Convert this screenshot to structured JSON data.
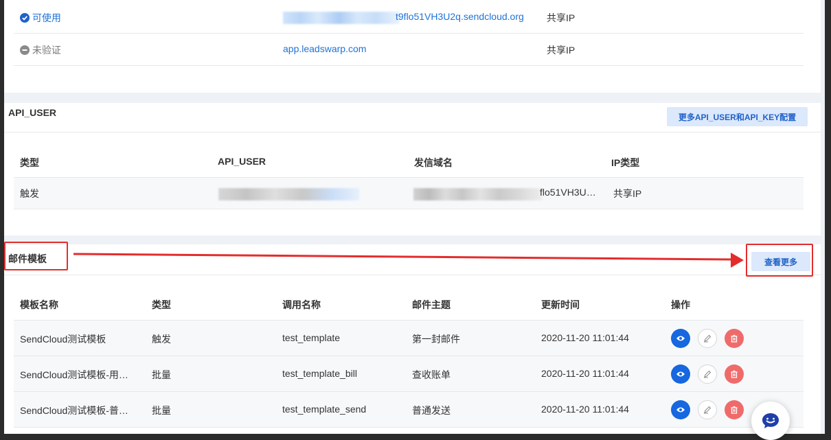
{
  "domains": {
    "rows": [
      {
        "status": "可使用",
        "domain": "t9flo51VH3U2q.sendcloud.org",
        "ip": "共享IP"
      },
      {
        "status": "未验证",
        "domain": "app.leadswarp.com",
        "ip": "共享IP"
      }
    ]
  },
  "api_user": {
    "title": "API_USER",
    "more_button": "更多API_USER和API_KEY配置",
    "headers": [
      "类型",
      "API_USER",
      "发信域名",
      "IP类型"
    ],
    "row": {
      "type": "触发",
      "domain_suffix": "flo51VH3U…",
      "ip": "共享IP"
    }
  },
  "templates": {
    "title": "邮件模板",
    "more_button": "查看更多",
    "headers": [
      "模板名称",
      "类型",
      "调用名称",
      "邮件主题",
      "更新时间",
      "操作"
    ],
    "rows": [
      {
        "name": "SendCloud测试模板",
        "type": "触发",
        "call": "test_template",
        "subject": "第一封邮件",
        "time": "2020-11-20 11:01:44"
      },
      {
        "name": "SendCloud测试模板-用…",
        "type": "批量",
        "call": "test_template_bill",
        "subject": "查收账单",
        "time": "2020-11-20 11:01:44"
      },
      {
        "name": "SendCloud测试模板-普…",
        "type": "批量",
        "call": "test_template_send",
        "subject": "普通发送",
        "time": "2020-11-20 11:01:44"
      }
    ]
  },
  "icons": {
    "status_ok": "check-circle-icon",
    "status_pending": "minus-circle-icon",
    "view": "eye-icon",
    "edit": "pen-icon",
    "delete": "trash-icon",
    "chat": "chat-icon"
  },
  "colors": {
    "accent": "#1667e0",
    "danger": "#ef6b6b",
    "highlight": "#e42c2c"
  }
}
